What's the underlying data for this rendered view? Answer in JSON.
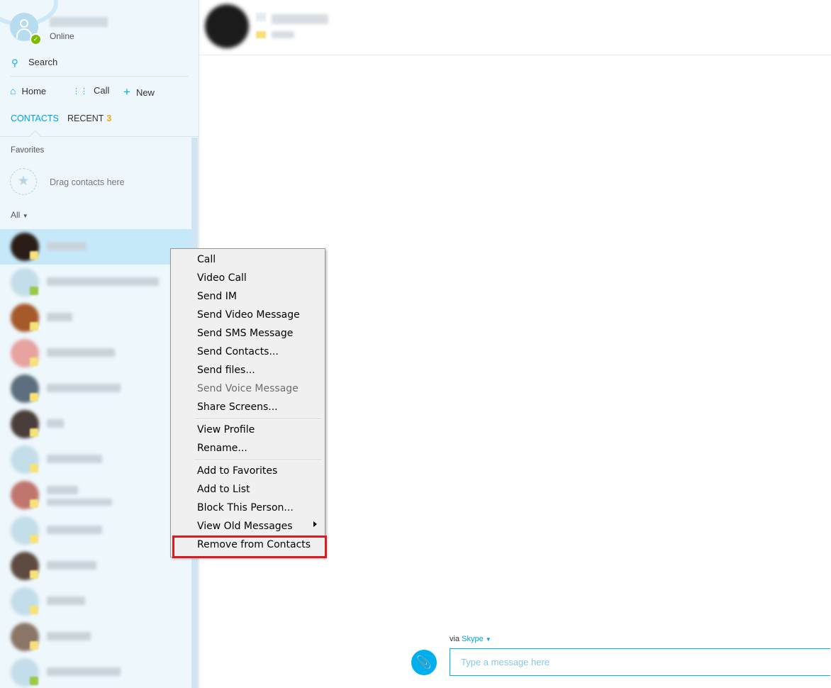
{
  "profile": {
    "status": "Online",
    "presence_color": "#7cbb00"
  },
  "search": {
    "label": "Search",
    "icon": "search-icon"
  },
  "nav": {
    "home": "Home",
    "call": "Call",
    "new": "New"
  },
  "tabs": {
    "contacts": "CONTACTS",
    "recent": "RECENT",
    "recent_count": "3"
  },
  "favorites": {
    "label": "Favorites",
    "drag_hint": "Drag contacts here"
  },
  "filter": {
    "label": "All"
  },
  "composer": {
    "via": "via",
    "service": "Skype",
    "placeholder": "Type a message here"
  },
  "context_menu": {
    "items": [
      "Call",
      "Video Call",
      "Send IM",
      "Send Video Message",
      "Send SMS Message",
      "Send Contacts...",
      "Send files...",
      "Send Voice Message",
      "Share Screens...",
      "View Profile",
      "Rename...",
      "Add to Favorites",
      "Add to List",
      "Block This Person...",
      "View Old Messages",
      "Remove from Contacts"
    ],
    "disabled_item": "Send Voice Message",
    "highlighted_item": "Remove from Contacts",
    "highlight_color": "#e0191f"
  },
  "colors": {
    "accent": "#00aff0",
    "sidebar_bg": "#eef7fc",
    "selected_row": "#c6e9fa",
    "recent_badge": "#f7a21b"
  }
}
